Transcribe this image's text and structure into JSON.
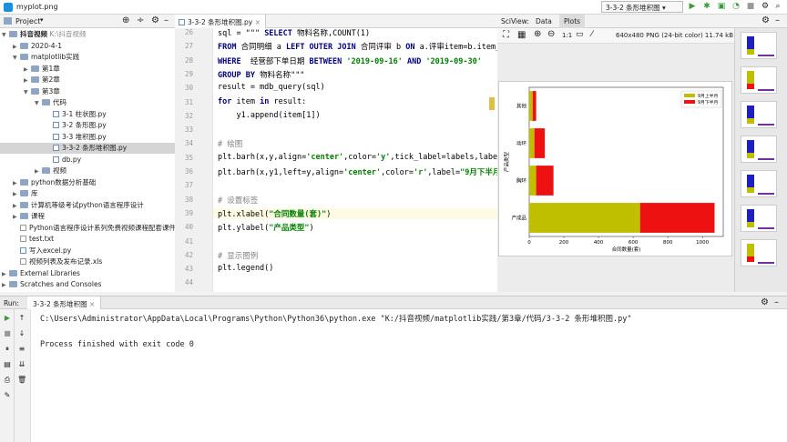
{
  "window": {
    "title": "myplot.png",
    "run_config": "3-3-2 条形堆积图"
  },
  "project": {
    "header": "Project",
    "tree": [
      {
        "label": "抖音视频",
        "sub": "K:\\抖音视频",
        "depth": 0,
        "expanded": true,
        "type": "folder"
      },
      {
        "label": "2020-4-1",
        "depth": 1,
        "expanded": false,
        "type": "folder"
      },
      {
        "label": "matplotlib实践",
        "depth": 1,
        "expanded": true,
        "type": "folder"
      },
      {
        "label": "第1章",
        "depth": 2,
        "expanded": false,
        "type": "folder"
      },
      {
        "label": "第2章",
        "depth": 2,
        "expanded": false,
        "type": "folder"
      },
      {
        "label": "第3章",
        "depth": 2,
        "expanded": true,
        "type": "folder"
      },
      {
        "label": "代码",
        "depth": 3,
        "expanded": true,
        "type": "folder"
      },
      {
        "label": "3-1 柱状图.py",
        "depth": 4,
        "type": "py"
      },
      {
        "label": "3-2 条形图.py",
        "depth": 4,
        "type": "py"
      },
      {
        "label": "3-3 堆积图.py",
        "depth": 4,
        "type": "py"
      },
      {
        "label": "3-3-2 条形堆积图.py",
        "depth": 4,
        "type": "py",
        "selected": true
      },
      {
        "label": "db.py",
        "depth": 4,
        "type": "py"
      },
      {
        "label": "视频",
        "depth": 3,
        "expanded": false,
        "type": "folder"
      },
      {
        "label": "python数据分析基础",
        "depth": 1,
        "expanded": false,
        "type": "folder"
      },
      {
        "label": "库",
        "depth": 1,
        "expanded": false,
        "type": "folder"
      },
      {
        "label": "计算机等级考试python语言程序设计",
        "depth": 1,
        "expanded": false,
        "type": "folder"
      },
      {
        "label": "课程",
        "depth": 1,
        "expanded": false,
        "type": "folder"
      },
      {
        "label": "Python语言程序设计系列免费视频课程配套课件.d",
        "depth": 1,
        "type": "txt"
      },
      {
        "label": "test.txt",
        "depth": 1,
        "type": "txt"
      },
      {
        "label": "写入excel.py",
        "depth": 1,
        "type": "py"
      },
      {
        "label": "视频列表及发布记录.xls",
        "depth": 1,
        "type": "txt"
      },
      {
        "label": "External Libraries",
        "depth": 0,
        "expanded": false,
        "type": "folder"
      },
      {
        "label": "Scratches and Consoles",
        "depth": 0,
        "expanded": false,
        "type": "folder"
      }
    ]
  },
  "editor": {
    "tab": "3-3-2 条形堆积图.py",
    "lines": [
      {
        "n": "26",
        "html": "sql = \"\"\" <span class=\"kw\">SELECT</span> 物料名称,COUNT(1)"
      },
      {
        "n": "27",
        "html": "<span class=\"kw\">FROM</span> 合同明细 a <span class=\"kw\">LEFT OUTER JOIN</span> 合同评审 b <span class=\"kw\">ON</span> a.评审item=b.item_"
      },
      {
        "n": "28",
        "html": "<span class=\"kw\">WHERE</span>  经营部下单日期 <span class=\"kw\">BETWEEN</span> <span class=\"str\">'2019-09-16'</span> <span class=\"kw\">AND</span> <span class=\"str\">'2019-09-30'</span>"
      },
      {
        "n": "29",
        "html": "<span class=\"kw\">GROUP BY</span> 物料名称\"\"\""
      },
      {
        "n": "30",
        "html": "result = mdb_query(sql)"
      },
      {
        "n": "31",
        "html": "<span class=\"kw\">for</span> item <span class=\"kw\">in</span> result:"
      },
      {
        "n": "32",
        "html": "    y1.append(item[1])"
      },
      {
        "n": "33",
        "html": ""
      },
      {
        "n": "34",
        "html": "<span class=\"cm\"># 绘图</span>"
      },
      {
        "n": "35",
        "html": "plt.barh(x,y,align=<span class=\"str\">'center'</span>,color=<span class=\"str\">'y'</span>,tick_label=labels,label=<span class=\"str\">\"9</span>"
      },
      {
        "n": "36",
        "html": "plt.barh(x,y1,left=y,align=<span class=\"str\">'center'</span>,color=<span class=\"str\">'r'</span>,label=<span class=\"str\">\"9月下半月</span>"
      },
      {
        "n": "37",
        "html": ""
      },
      {
        "n": "38",
        "html": "<span class=\"cm\"># 设置标签</span>"
      },
      {
        "n": "39",
        "html": "plt.xlabel(<span class=\"str\">\"合同数量(套)\"</span>)",
        "hl": true
      },
      {
        "n": "40",
        "html": "plt.ylabel(<span class=\"str\">\"产品类型\"</span>)"
      },
      {
        "n": "41",
        "html": ""
      },
      {
        "n": "42",
        "html": "<span class=\"cm\"># 显示图例</span>"
      },
      {
        "n": "43",
        "html": "plt.legend()"
      },
      {
        "n": "44",
        "html": ""
      }
    ]
  },
  "sciview": {
    "label": "SciView:",
    "tabs": [
      "Data",
      "Plots"
    ],
    "active_tab": "Plots",
    "zoom": "1:1",
    "image_info": "640x480 PNG (24-bit color) 11.74 kB"
  },
  "chart_data": {
    "type": "bar",
    "orientation": "horizontal",
    "stacked": true,
    "categories": [
      "产成品",
      "胸环",
      "动环",
      "其他"
    ],
    "series": [
      {
        "name": "9月上半月",
        "color": "#bfbf00",
        "values": [
          640,
          40,
          30,
          20
        ]
      },
      {
        "name": "9月下半月",
        "color": "#ee1111",
        "values": [
          430,
          100,
          60,
          20
        ]
      }
    ],
    "xlabel": "合同数量(套)",
    "ylabel": "产品类型",
    "xticks": [
      0,
      200,
      400,
      600,
      800,
      1000
    ],
    "xlim": [
      0,
      1120
    ],
    "legend": "top-right"
  },
  "run": {
    "label": "Run:",
    "tab": "3-3-2 条形堆积图",
    "command": "C:\\Users\\Administrator\\AppData\\Local\\Programs\\Python\\Python36\\python.exe \"K:/抖音视频/matplotlib实践/第3章/代码/3-3-2 条形堆积图.py\"",
    "exit": "Process finished with exit code 0"
  },
  "colors": {
    "keyword": "#000080",
    "string": "#008000",
    "comment": "#808080",
    "selection": "#d5d5d5",
    "run_green": "#3c9a3c"
  }
}
